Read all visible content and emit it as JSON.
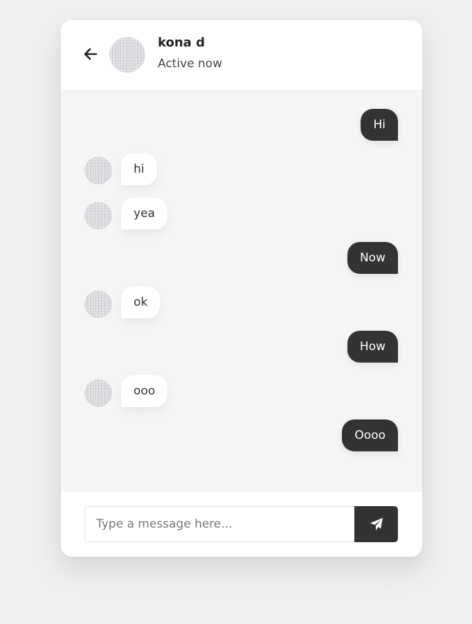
{
  "header": {
    "name": "kona d",
    "status": "Active now",
    "back_icon": "arrow-left-icon"
  },
  "messages": [
    {
      "direction": "outgoing",
      "text": "Hi"
    },
    {
      "direction": "incoming",
      "text": "hi"
    },
    {
      "direction": "incoming",
      "text": "yea"
    },
    {
      "direction": "outgoing",
      "text": "Now"
    },
    {
      "direction": "incoming",
      "text": "ok"
    },
    {
      "direction": "outgoing",
      "text": "How"
    },
    {
      "direction": "incoming",
      "text": "ooo"
    },
    {
      "direction": "outgoing",
      "text": "Oooo"
    }
  ],
  "input": {
    "placeholder": "Type a message here...",
    "value": ""
  },
  "send": {
    "icon": "paper-plane-icon"
  },
  "colors": {
    "dark": "#333333",
    "chat_background": "#f5f5f5",
    "page_background": "#efefef"
  }
}
